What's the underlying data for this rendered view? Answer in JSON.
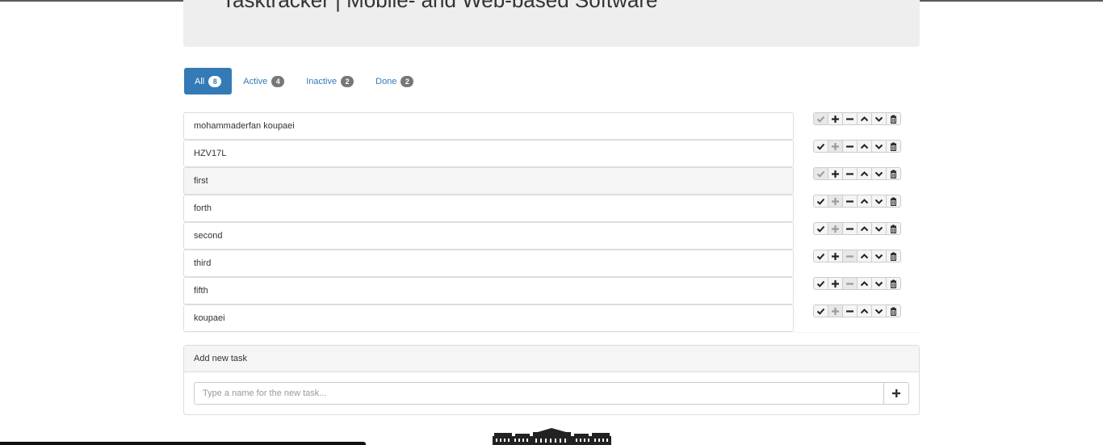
{
  "app": {
    "title": "Tasktracker | Mobile- and Web-based Software"
  },
  "filters": [
    {
      "label": "All",
      "count": "8",
      "active": true
    },
    {
      "label": "Active",
      "count": "4",
      "active": false
    },
    {
      "label": "Inactive",
      "count": "2",
      "active": false
    },
    {
      "label": "Done",
      "count": "2",
      "active": false
    }
  ],
  "tasks": [
    {
      "name": "mohammaderfan koupaei",
      "selected": false,
      "done_enabled": false,
      "activate_enabled": true,
      "deactivate_enabled": true
    },
    {
      "name": "HZV17L",
      "selected": false,
      "done_enabled": true,
      "activate_enabled": false,
      "deactivate_enabled": true
    },
    {
      "name": "first",
      "selected": true,
      "done_enabled": false,
      "activate_enabled": true,
      "deactivate_enabled": true
    },
    {
      "name": "forth",
      "selected": false,
      "done_enabled": true,
      "activate_enabled": false,
      "deactivate_enabled": true
    },
    {
      "name": "second",
      "selected": false,
      "done_enabled": true,
      "activate_enabled": false,
      "deactivate_enabled": true
    },
    {
      "name": "third",
      "selected": false,
      "done_enabled": true,
      "activate_enabled": true,
      "deactivate_enabled": false
    },
    {
      "name": "fifth",
      "selected": false,
      "done_enabled": true,
      "activate_enabled": true,
      "deactivate_enabled": false
    },
    {
      "name": "koupaei",
      "selected": false,
      "done_enabled": true,
      "activate_enabled": false,
      "deactivate_enabled": true
    }
  ],
  "row_actions": [
    "check-icon",
    "plus-icon",
    "minus-icon",
    "chevron-up-icon",
    "chevron-down-icon",
    "trash-icon"
  ],
  "add_task": {
    "heading": "Add new task",
    "placeholder": "Type a name for the new task...",
    "button_icon": "plus-icon"
  },
  "footer": {
    "logo_icon": "university-building-icon"
  },
  "colors": {
    "primary": "#337ab7",
    "badge": "#777777",
    "jumbotron": "#eeeeee"
  }
}
